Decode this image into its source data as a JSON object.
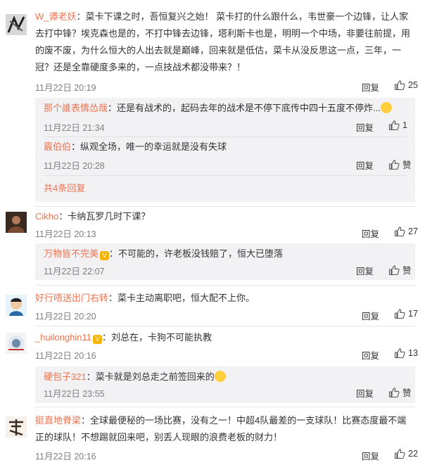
{
  "reply_label": "回复",
  "zan_label": "赞",
  "c1": {
    "user": "W_谭老妖",
    "sep": "：",
    "text": "菜卡下课之时，吾恒复兴之始！ 菜卡打的什么跟什么，韦世豪一个边锋，让人家去打中锋？埃克森也是的，不打中锋去边锋，塔利斯卡也是，明明一个中场，非要往前提，用的废不废，为什么恒大的人出去就是巅峰，回来就是低估，菜卡从没反思这一点，三年，一冠？还是全靠硬度多来的，一点技战术都没带来？！",
    "date": "11月22日 20:19",
    "likes": "25",
    "subs": [
      {
        "user": "那个誰表情怂哉",
        "sep": "：",
        "text": "还是有战术的，起码去年的战术是不停下底传中四十五度不停炸...",
        "date": "11月22日 21:34",
        "likes": "1"
      },
      {
        "user": "霰伯伯",
        "sep": "：",
        "text": "纵观全场，唯一的幸运就是没有失球",
        "date": "11月22日 20:28",
        "likes": "赞"
      }
    ],
    "more": "共4条回复"
  },
  "c2": {
    "user": "Cikho",
    "sep": "：",
    "text": "卡纳瓦罗几时下课？",
    "date": "11月22日 20:13",
    "likes": "27",
    "subs": [
      {
        "user": "万物皆不完美",
        "sep": "：",
        "text": "不可能的，许老板没钱赔了，恒大已堕落",
        "date": "11月22日 22:07",
        "likes": "赞"
      }
    ]
  },
  "c3": {
    "user": "好行唔送出门右转",
    "sep": "：",
    "text": "菜卡主动离职吧，恒大配不上你。",
    "date": "11月22日 20:20",
    "likes": "17"
  },
  "c4": {
    "user": "_huilonghin11",
    "sep": "：",
    "text": "刘总在，卡狗不可能执教",
    "date": "11月22日 20:16",
    "likes": "13",
    "subs": [
      {
        "user": "硬包子321",
        "sep": "：",
        "text": "菜卡就是刘总走之前签回来的",
        "date": "11月22日 23:55",
        "likes": "赞"
      }
    ]
  },
  "c5": {
    "user": "挺直地脊梁",
    "sep": "：",
    "text": "全球最便秘的一场比赛，没有之一！中超4队最差的一支球队！比赛态度最不端正的球队！不想踢就回来吧，别丢人现眼的浪费老板的财力！",
    "date": "11月22日 20:16",
    "likes": "22"
  },
  "colors": {
    "username": "#eb7350",
    "date": "#808080",
    "sub_bg": "#f2f2f5"
  }
}
